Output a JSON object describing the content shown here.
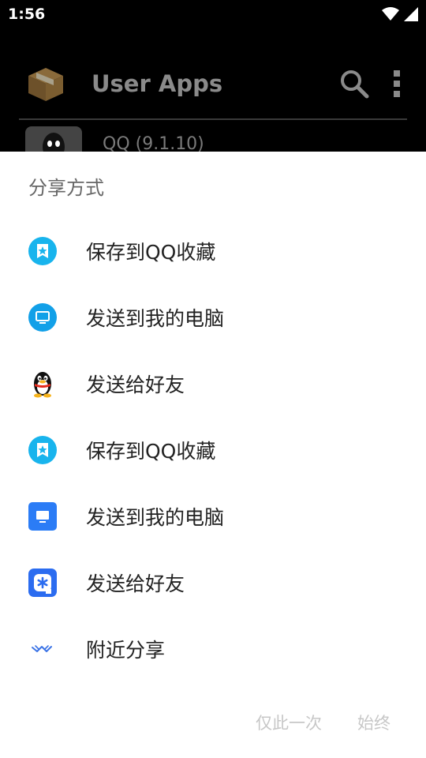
{
  "status_bar": {
    "time": "1:56"
  },
  "app_bar": {
    "title": "User Apps"
  },
  "background_list": {
    "first_item": "QQ (9.1.10)"
  },
  "share_sheet": {
    "title": "分享方式",
    "items": [
      {
        "label": "保存到QQ收藏",
        "icon": "qq-favorites-icon"
      },
      {
        "label": "发送到我的电脑",
        "icon": "my-computer-icon"
      },
      {
        "label": "发送给好友",
        "icon": "qq-penguin-icon"
      },
      {
        "label": "保存到QQ收藏",
        "icon": "qq-favorites-icon"
      },
      {
        "label": "发送到我的电脑",
        "icon": "computer-square-icon"
      },
      {
        "label": "发送给好友",
        "icon": "tim-icon"
      },
      {
        "label": "附近分享",
        "icon": "nearby-share-icon"
      }
    ],
    "buttons": {
      "just_once": "仅此一次",
      "always": "始终"
    }
  }
}
